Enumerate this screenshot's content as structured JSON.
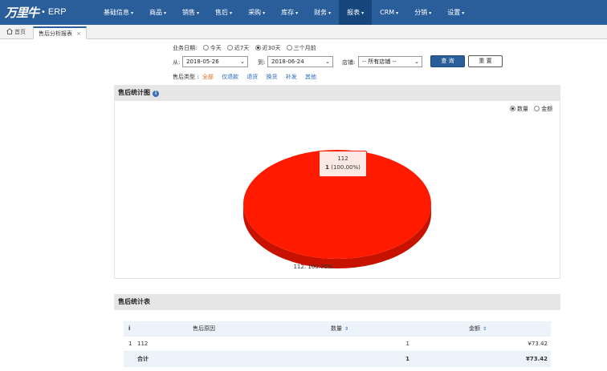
{
  "app": {
    "brand": "万里牛",
    "dot": "•",
    "product": "ERP"
  },
  "nav": [
    {
      "label": "基础信息",
      "active": false
    },
    {
      "label": "商品",
      "active": false
    },
    {
      "label": "销售",
      "active": false
    },
    {
      "label": "售后",
      "active": false
    },
    {
      "label": "采购",
      "active": false
    },
    {
      "label": "库存",
      "active": false
    },
    {
      "label": "财务",
      "active": false
    },
    {
      "label": "报表",
      "active": true
    },
    {
      "label": "CRM",
      "active": false
    },
    {
      "label": "分销",
      "active": false
    },
    {
      "label": "设置",
      "active": false
    }
  ],
  "tabs": {
    "home": "首页",
    "current": "售后分析报表",
    "close": "×"
  },
  "filter": {
    "date_label": "业务日期:",
    "date_options": [
      "今天",
      "近7天",
      "近30天",
      "三个月前"
    ],
    "date_selected": 2,
    "from_label": "从:",
    "from_value": "2018-05-26",
    "to_label": "到:",
    "to_value": "2018-06-24",
    "shop_label": "店铺:",
    "shop_value": "-- 所有店铺 --",
    "query_button": "查 询",
    "reset_button": "重 置",
    "type_label": "售后类型 :",
    "types": [
      "全部",
      "仅退款",
      "退货",
      "换货",
      "补发",
      "其他"
    ]
  },
  "chart_panel": {
    "title": "售后统计图",
    "info_icon": "i",
    "modes": [
      "数量",
      "金额"
    ],
    "mode_selected": 0
  },
  "chart_data": {
    "type": "pie",
    "categories": [
      "112"
    ],
    "values": [
      1
    ],
    "percentages": [
      100.0
    ],
    "colors": [
      "#ff1a00"
    ],
    "tooltip": {
      "name": "112",
      "value": "1",
      "percent": "(100.00%)"
    },
    "slice_label": "112: 100.00%"
  },
  "table_panel": {
    "title": "售后统计表",
    "columns": [
      "i",
      "售后原因",
      "数量",
      "金额"
    ],
    "rows": [
      {
        "index": "1",
        "reason": "112",
        "quantity": "1",
        "amount": "¥73.42"
      }
    ],
    "total": {
      "label": "合计",
      "quantity": "1",
      "amount": "¥73.42"
    }
  }
}
